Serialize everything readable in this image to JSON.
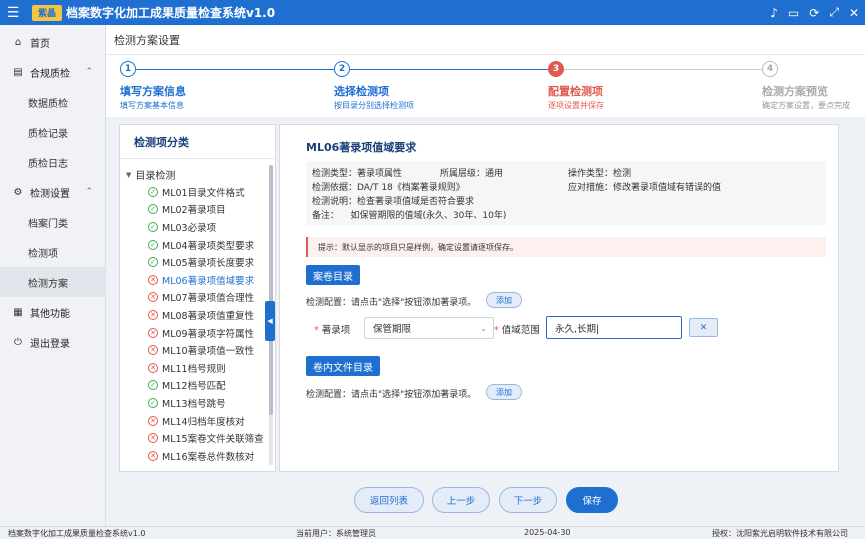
{
  "app": {
    "title": "档案数字化加工成果质量检查系统v1.0",
    "logo_text": "紫晶",
    "controls": [
      "♪",
      "▭",
      "⟳",
      "⤢",
      "✕"
    ]
  },
  "sidebar": {
    "home": "首页",
    "compliance": "合规质检",
    "compliance_items": [
      "数据质检",
      "质检记录",
      "质检日志"
    ],
    "settings": "检测设置",
    "settings_items": [
      "档案门类",
      "检测项",
      "检测方案"
    ],
    "other": "其他功能",
    "logout": "退出登录"
  },
  "breadcrumb": "检测方案设置",
  "steps": [
    {
      "num": "1",
      "title": "填写方案信息",
      "desc": "填写方案基本信息",
      "state": "done"
    },
    {
      "num": "2",
      "title": "选择检测项",
      "desc": "按目录分别选择检测项",
      "state": "done"
    },
    {
      "num": "3",
      "title": "配置检测项",
      "desc": "逐项设置并保存",
      "state": "current"
    },
    {
      "num": "4",
      "title": "检测方案预览",
      "desc": "确定方案设置，要点完成",
      "state": "todo"
    }
  ],
  "tree": {
    "heading": "检测项分类",
    "root": "目录检测",
    "items": [
      {
        "label": "ML01目录文件格式",
        "status": "ok"
      },
      {
        "label": "ML02著录项目",
        "status": "ok"
      },
      {
        "label": "ML03必录项",
        "status": "ok"
      },
      {
        "label": "ML04著录项类型要求",
        "status": "ok"
      },
      {
        "label": "ML05著录项长度要求",
        "status": "ok"
      },
      {
        "label": "ML06著录项值域要求",
        "status": "err"
      },
      {
        "label": "ML07著录项值合理性",
        "status": "err"
      },
      {
        "label": "ML08著录项值重复性",
        "status": "err"
      },
      {
        "label": "ML09著录项字符属性",
        "status": "err"
      },
      {
        "label": "ML10著录项值一致性",
        "status": "err"
      },
      {
        "label": "ML11档号规则",
        "status": "err"
      },
      {
        "label": "ML12档号匹配",
        "status": "ok"
      },
      {
        "label": "ML13档号跳号",
        "status": "ok"
      },
      {
        "label": "ML14归档年度核对",
        "status": "err"
      },
      {
        "label": "ML15案卷文件关联筛查",
        "status": "err"
      },
      {
        "label": "ML16案卷总件数核对",
        "status": "err"
      }
    ]
  },
  "detail": {
    "title": "ML06著录项值域要求",
    "info": {
      "type": "检测类型：著录项属性",
      "level": "所属层级：通用",
      "op": "操作类型：检测",
      "basis": "检测依据：DA/T 18《档案著录规则》",
      "measure": "应对措施：修改著录项值域有错误的值",
      "desc": "检测说明：检查著录项值域是否符合要求",
      "note": "备注：    如保管期限的值域(永久、30年、10年)"
    },
    "tip": "提示：默认显示的项目只是样例，确定设置请逐项保存。",
    "section1": "案卷目录",
    "config_text": "检测配置：请点击\"选择\"按钮添加著录项。",
    "add_label": "添加",
    "field_label": "著录项",
    "field_value": "保管期限",
    "range_label": "值域范围",
    "range_value": "永久,长期|",
    "delete_label": "✕",
    "section2": "卷内文件目录"
  },
  "footer_buttons": {
    "back": "返回列表",
    "prev": "上一步",
    "next": "下一步",
    "save": "保存"
  },
  "status": {
    "app": "档案数字化加工成果质量检查系统v1.0",
    "user": "当前用户：系统管理员",
    "date": "2025-04-30",
    "license": "授权：沈阳紫光启明软件技术有限公司"
  },
  "colors": {
    "primary": "#1f6fd1",
    "current_step": "#e05a4f",
    "ok": "#3cae4f",
    "error": "#e05a4f"
  }
}
